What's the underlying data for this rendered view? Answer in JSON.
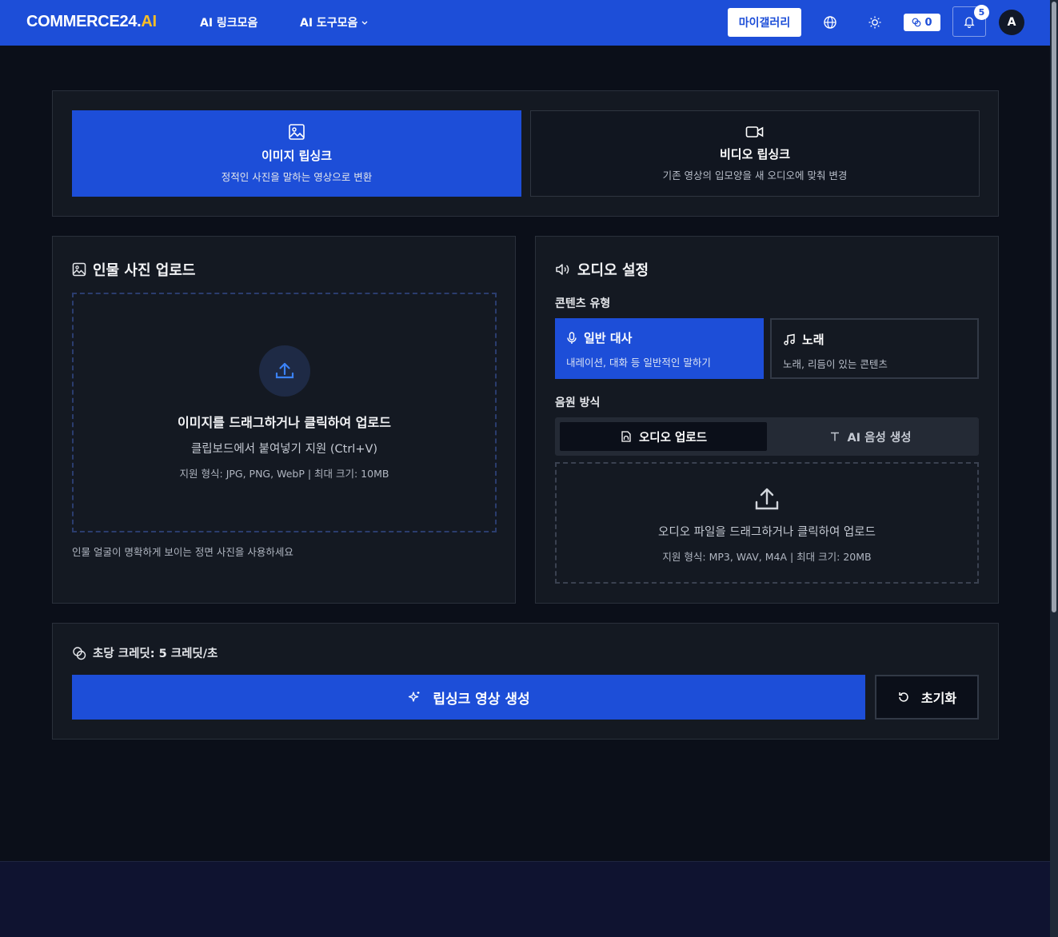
{
  "header": {
    "logo_main": "COMMERCE24.",
    "logo_suffix": "AI",
    "nav": [
      {
        "label": "AI 링크모음"
      },
      {
        "label": "AI 도구모음"
      }
    ],
    "gallery_label": "마이갤러리",
    "credits": "0",
    "notification_count": "5",
    "avatar_letter": "A"
  },
  "modes": [
    {
      "title": "이미지 립싱크",
      "desc": "정적인 사진을 말하는 영상으로 변환",
      "active": true
    },
    {
      "title": "비디오 립싱크",
      "desc": "기존 영상의 입모양을 새 오디오에 맞춰 변경",
      "active": false
    }
  ],
  "photo_upload": {
    "title": "인물 사진 업로드",
    "drop_title": "이미지를 드래그하거나 클릭하여 업로드",
    "drop_sub": "클립보드에서 붙여넣기 지원 (Ctrl+V)",
    "drop_note": "지원 형식: JPG, PNG, WebP | 최대 크기: 10MB",
    "hint": "인물 얼굴이 명확하게 보이는 정면 사진을 사용하세요"
  },
  "audio": {
    "title": "오디오 설정",
    "content_type_label": "콘텐츠 유형",
    "types": [
      {
        "title": "일반 대사",
        "desc": "내레이션, 대화 등 일반적인 말하기",
        "active": true
      },
      {
        "title": "노래",
        "desc": "노래, 리듬이 있는 콘텐츠",
        "active": false
      }
    ],
    "source_label": "음원 방식",
    "sources": [
      {
        "label": "오디오 업로드",
        "active": true
      },
      {
        "label": "AI 음성 생성",
        "active": false
      }
    ],
    "drop_title": "오디오 파일을 드래그하거나 클릭하여 업로드",
    "drop_note": "지원 형식: MP3, WAV, M4A | 최대 크기: 20MB"
  },
  "actions": {
    "credit_rate": "초당 크레딧: 5 크레딧/초",
    "generate_label": "립싱크 영상 생성",
    "reset_label": "초기화"
  },
  "colors": {
    "primary": "#1d4ed8",
    "background": "#0b0f19",
    "card": "#141922"
  }
}
